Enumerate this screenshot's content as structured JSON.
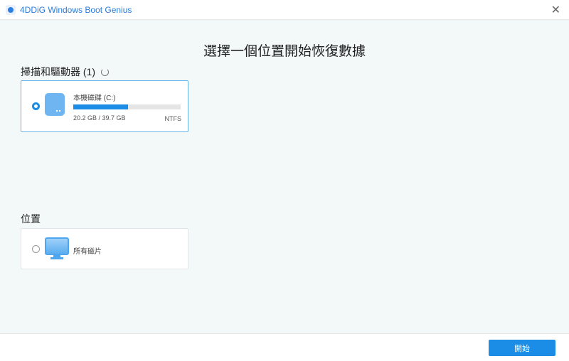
{
  "window": {
    "title": "4DDiG Windows Boot Genius",
    "close_label": "✕"
  },
  "main": {
    "heading": "選擇一個位置開始恢復數據",
    "drives_section": {
      "title": "掃描和驅動器 (1)",
      "drives": [
        {
          "name": "本機磁碟 (C:)",
          "usage": "20.2 GB / 39.7 GB",
          "used_fraction": 0.51,
          "filesystem": "NTFS",
          "selected": true
        }
      ]
    },
    "location_section": {
      "title": "位置",
      "locations": [
        {
          "name": "所有磁片",
          "selected": false
        }
      ]
    }
  },
  "footer": {
    "start_label": "開始"
  },
  "colors": {
    "accent": "#1b8de6"
  }
}
